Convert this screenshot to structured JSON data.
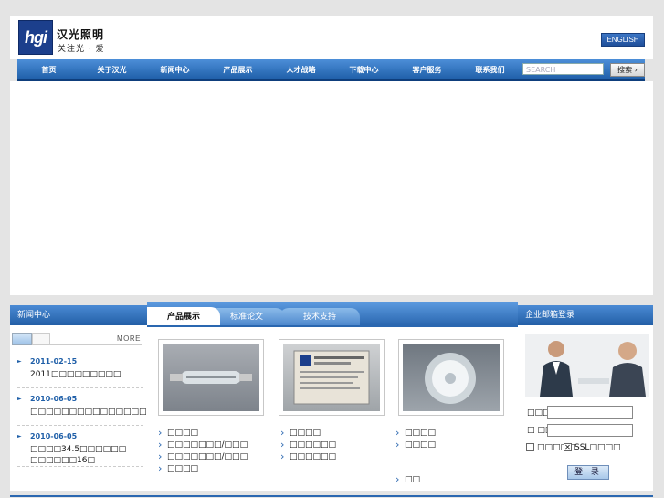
{
  "header": {
    "logo_text": "hgi",
    "brand_name": "汉光照明",
    "slogan": "关注光 · 爱",
    "english_button": "ENGLISH"
  },
  "nav": {
    "items": [
      {
        "label": "首页"
      },
      {
        "label": "关于汉光"
      },
      {
        "label": "新闻中心"
      },
      {
        "label": "产品展示"
      },
      {
        "label": "人才战略"
      },
      {
        "label": "下载中心"
      },
      {
        "label": "客户服务"
      },
      {
        "label": "联系我们"
      }
    ],
    "search_placeholder": "SEARCH",
    "search_button": "搜索 ›"
  },
  "news": {
    "title": "新闻中心",
    "more": "MORE",
    "items": [
      {
        "date": "2011-02-15",
        "title": "2011□□□□□□□□□"
      },
      {
        "date": "2010-06-05",
        "title": "□□□□□□□□□□□□□□□□□□"
      },
      {
        "date": "2010-06-05",
        "title": "□□□□34.5□□□□□□ □□□□□□16□"
      }
    ]
  },
  "products": {
    "tabs": [
      "产品展示",
      "标准论文",
      "技术支持"
    ],
    "columns": [
      {
        "links": [
          "□□□□",
          "□□□□□□□/□□□",
          "□□□□□□□/□□□",
          "□□□□"
        ]
      },
      {
        "links": [
          "□□□□",
          "□□□□□□",
          "□□□□□□"
        ]
      },
      {
        "links": [
          "□□□□",
          "□□□□",
          "□□"
        ]
      }
    ]
  },
  "login": {
    "title": "企业邮箱登录",
    "username_label": "□□□□",
    "password_label": "□ □□",
    "remember_label": "□□□□□",
    "ssl_label": "SSL□□□□",
    "submit": "登 录"
  },
  "colors": {
    "primary_blue": "#2a67b0",
    "nav_gradient_top": "#4c8ed8",
    "logo_blue": "#1c3f8c",
    "background": "#e4e4e4"
  }
}
